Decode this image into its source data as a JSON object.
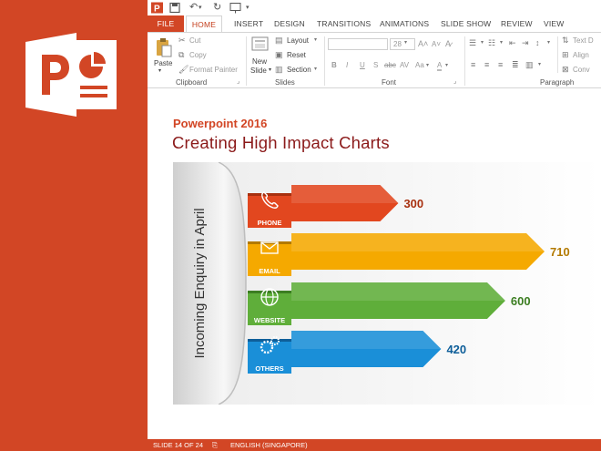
{
  "brand": {
    "accent": "#D24625",
    "icon": "powerpoint-logo-icon"
  },
  "tabs": [
    "FILE",
    "HOME",
    "INSERT",
    "DESIGN",
    "TRANSITIONS",
    "ANIMATIONS",
    "SLIDE SHOW",
    "REVIEW",
    "VIEW"
  ],
  "active_tab": "HOME",
  "ribbon": {
    "clipboard": {
      "paste": "Paste",
      "cut": "Cut",
      "copy": "Copy",
      "format_painter": "Format Painter",
      "label": "Clipboard"
    },
    "slides": {
      "new_slide_line1": "New",
      "new_slide_line2": "Slide",
      "layout": "Layout",
      "reset": "Reset",
      "section": "Section",
      "label": "Slides"
    },
    "font": {
      "size": "28",
      "label": "Font",
      "bold": "B",
      "italic": "I",
      "underline": "U",
      "strike": "S",
      "spacing": "abc",
      "case": "Aa",
      "color": "A"
    },
    "paragraph": {
      "text_direction": "Text D",
      "align": "Align",
      "convert": "Conv",
      "label": "Paragraph"
    }
  },
  "slide": {
    "subtitle": "Powerpoint 2016",
    "title": "Creating High Impact Charts"
  },
  "chart_data": {
    "type": "bar",
    "ylabel": "Incoming Enquiry in April",
    "categories": [
      "PHONE",
      "EMAIL",
      "WEBSITE",
      "OTHERS"
    ],
    "values": [
      300,
      710,
      600,
      420
    ],
    "colors": [
      "#E2471F",
      "#F5A900",
      "#5FAE3A",
      "#1A8FD8"
    ],
    "dark_colors": [
      "#A8300F",
      "#B37A00",
      "#3C7E22",
      "#0E5E99"
    ],
    "icons": [
      "phone-icon",
      "email-icon",
      "globe-icon",
      "gears-icon"
    ]
  },
  "status": {
    "slide": "SLIDE 14 OF 24",
    "language": "ENGLISH (SINGAPORE)"
  }
}
